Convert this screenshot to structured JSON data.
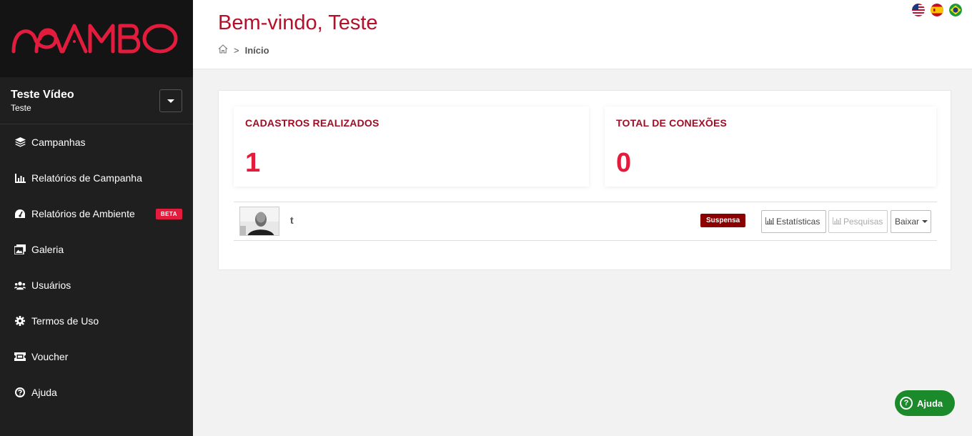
{
  "brand": {
    "name": "MAMBO",
    "color": "#e31c3d"
  },
  "user": {
    "name": "Teste Vídeo",
    "subtitle": "Teste"
  },
  "sidebar": {
    "items": [
      {
        "label": "Campanhas",
        "icon": "layers-icon"
      },
      {
        "label": "Relatórios de Campanha",
        "icon": "bar-chart-icon"
      },
      {
        "label": "Relatórios de Ambiente",
        "icon": "gauge-icon",
        "badge": "BETA"
      },
      {
        "label": "Galeria",
        "icon": "images-icon"
      },
      {
        "label": "Usuários",
        "icon": "users-icon"
      },
      {
        "label": "Termos de Uso",
        "icon": "gear-icon"
      },
      {
        "label": "Voucher",
        "icon": "ticket-icon"
      },
      {
        "label": "Ajuda",
        "icon": "question-circle-icon"
      }
    ]
  },
  "header": {
    "title": "Bem-vindo, Teste",
    "breadcrumb": {
      "separator": ">",
      "current": "Início"
    },
    "languages": [
      "en-US",
      "es",
      "pt-BR"
    ]
  },
  "stats": [
    {
      "label": "CADASTROS REALIZADOS",
      "value": "1"
    },
    {
      "label": "TOTAL DE CONEXÕES",
      "value": "0"
    }
  ],
  "campaign_row": {
    "name": "t",
    "status": "Suspensa",
    "buttons": {
      "stats": "Estatísticas",
      "surveys": "Pesquisas",
      "download": "Baixar"
    }
  },
  "help_button": {
    "label": "Ajuda"
  },
  "colors": {
    "sidebar_bg": "#1f1f1f",
    "title": "#b5102a",
    "accent": "#e31c3d",
    "status_badge": "#8b0000",
    "help": "#1a8a2b"
  }
}
